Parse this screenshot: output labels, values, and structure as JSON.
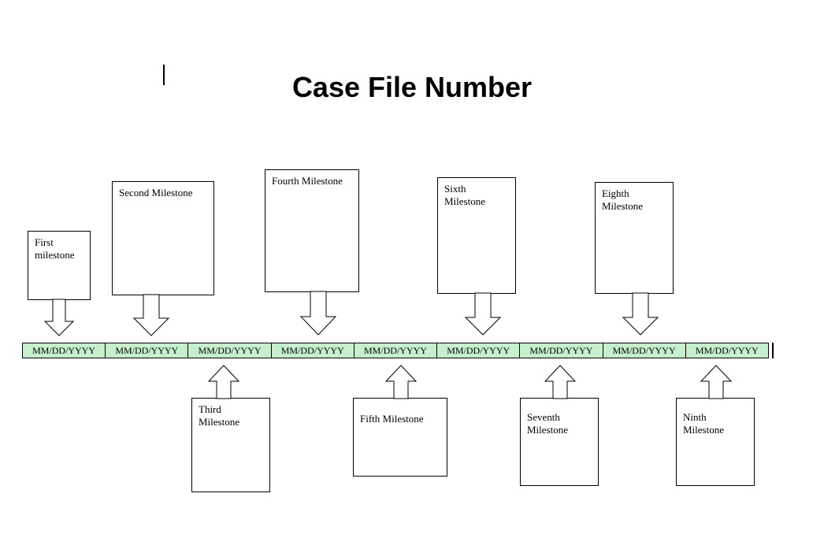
{
  "title": "Case File Number",
  "timeline": {
    "background": "#c6efce",
    "cells": [
      "MM/DD/YYYY",
      "MM/DD/YYYY",
      "MM/DD/YYYY",
      "MM/DD/YYYY",
      "MM/DD/YYYY",
      "MM/DD/YYYY",
      "MM/DD/YYYY",
      "MM/DD/YYYY",
      "MM/DD/YYYY"
    ]
  },
  "milestones": {
    "top": [
      {
        "label": "First\nmilestone"
      },
      {
        "label": "Second Milestone"
      },
      {
        "label": "Fourth Milestone"
      },
      {
        "label": "Sixth\nMilestone"
      },
      {
        "label": "Eighth\nMilestone"
      }
    ],
    "bottom": [
      {
        "label": "Third\nMilestone"
      },
      {
        "label": "Fifth Milestone"
      },
      {
        "label": "Seventh\nMilestone"
      },
      {
        "label": "Ninth\nMilestone"
      }
    ]
  }
}
